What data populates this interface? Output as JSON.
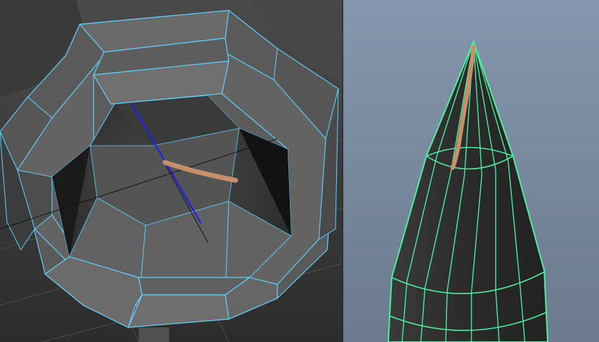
{
  "panels": [
    {
      "name": "viewport-left",
      "object": "octagonal-bevel-mesh",
      "selection": "edge-loop",
      "wire_color": "#5fd3ff",
      "selected_edge_color": "#1a1aff",
      "annotation_color": "#c8906a"
    },
    {
      "name": "viewport-right",
      "object": "cone-tip-mesh",
      "wire_color": "#4cf0a0",
      "background_top": "#8596ae",
      "background_bottom": "#6b7a8c",
      "annotation_color": "#c8906a"
    }
  ],
  "icons": [
    "stroke-annotation-icon"
  ]
}
